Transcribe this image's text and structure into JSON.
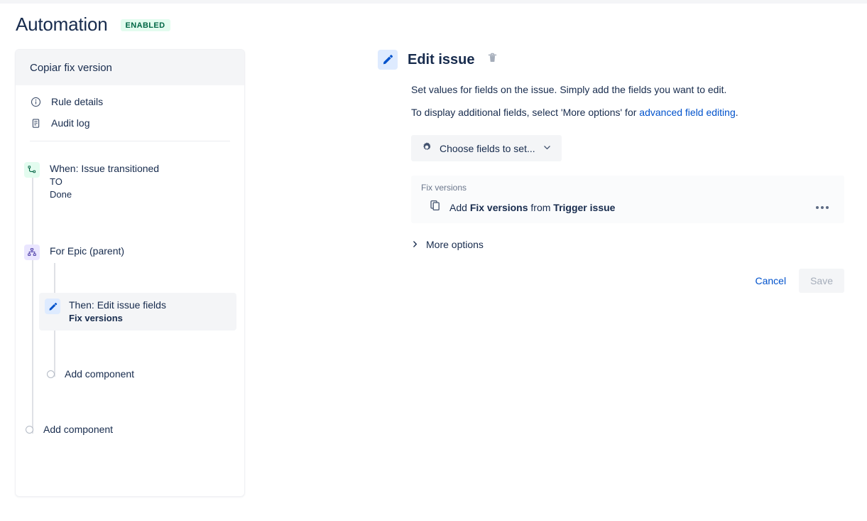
{
  "header": {
    "title": "Automation",
    "status": "ENABLED",
    "status_bg": "#E3FCEF",
    "status_color": "#006644"
  },
  "rule_card": {
    "title": "Copiar fix version",
    "nav": [
      {
        "label": "Rule details",
        "icon": "info-icon"
      },
      {
        "label": "Audit log",
        "icon": "document-icon"
      }
    ],
    "tree": {
      "trigger": {
        "title": "When: Issue transitioned",
        "sub1": "TO",
        "sub2": "Done",
        "icon": "transition-icon"
      },
      "branch": {
        "title": "For Epic (parent)",
        "icon": "hierarchy-icon"
      },
      "action": {
        "title": "Then: Edit issue fields",
        "sub": "Fix versions",
        "icon": "pencil-icon"
      },
      "add_component_nested": "Add component",
      "add_component_root": "Add component"
    }
  },
  "detail": {
    "title": "Edit issue",
    "icon": "pencil-icon",
    "delete_icon": "trash-icon",
    "description_1": "Set values for fields on the issue. Simply add the fields you want to edit.",
    "description_2_pre": "To display additional fields, select 'More options' for ",
    "description_2_link": "advanced field editing",
    "description_2_post": ".",
    "choose_fields_label": "Choose fields to set...",
    "choose_fields_icon": "gear-icon",
    "choose_fields_chevron": "chevron-down-icon",
    "field_section": {
      "label": "Fix versions",
      "row_icon": "copy-icon",
      "row_pre": "Add ",
      "row_bold_1": "Fix versions",
      "row_mid": " from ",
      "row_bold_2": "Trigger issue",
      "menu_icon": "ellipsis-icon"
    },
    "more_options_label": "More options",
    "more_options_icon": "chevron-right-icon",
    "cancel_label": "Cancel",
    "save_label": "Save"
  }
}
